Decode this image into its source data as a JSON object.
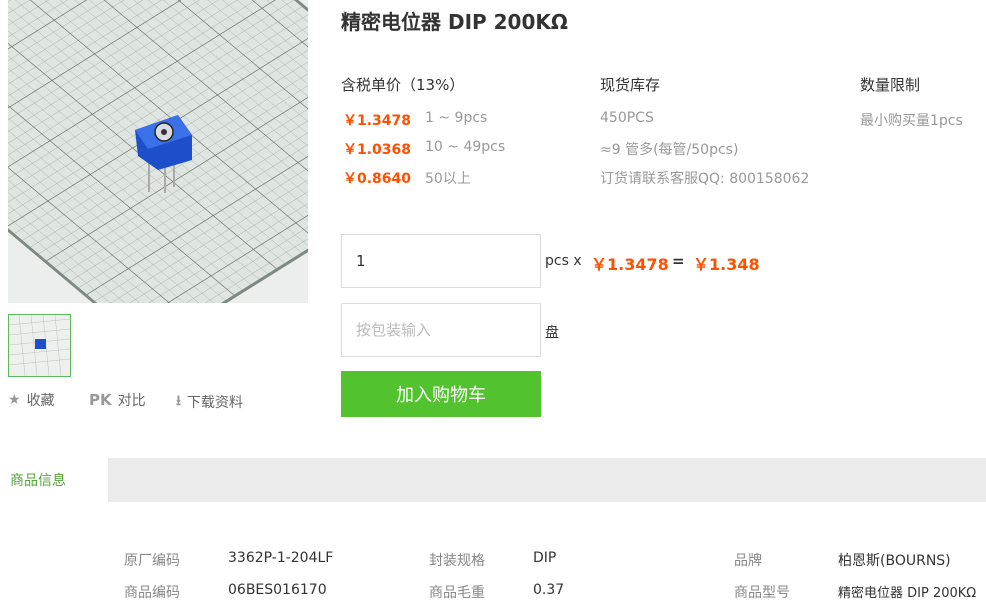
{
  "product": {
    "title": "精密电位器 DIP 200KΩ"
  },
  "image": {
    "alt": "product-photo"
  },
  "actions": [
    {
      "icon": "★",
      "label": "收藏"
    },
    {
      "icon": "PK",
      "label": "对比"
    },
    {
      "icon": "⭳",
      "label": "下载资料"
    }
  ],
  "pricing": {
    "header": "含税单价（13%）",
    "tiers": [
      {
        "price": "￥1.3478",
        "range": "1 ~ 9pcs"
      },
      {
        "price": "￥1.0368",
        "range": "10 ~ 49pcs"
      },
      {
        "price": "￥0.8640",
        "range": "50以上"
      }
    ]
  },
  "stock": {
    "header": "现货库存",
    "lines": [
      "450PCS",
      "≈9 管多(每管/50pcs)",
      "订货请联系客服QQ: 800158062"
    ]
  },
  "limit": {
    "header": "数量限制",
    "text": "最小购买量1pcs"
  },
  "order": {
    "qty_value": "1",
    "unit_label": "pcs x",
    "unit_price": "￥1.3478",
    "equals": "=",
    "total": "￥1.348",
    "pack_placeholder": "按包装输入",
    "pack_unit": "盘",
    "cart_label": "加入购物车"
  },
  "tabs": {
    "active": "商品信息"
  },
  "specs": {
    "row1": [
      {
        "label": "原厂编码",
        "value": "3362P-1-204LF"
      },
      {
        "label": "封装规格",
        "value": "DIP"
      },
      {
        "label": "品牌",
        "value": "柏恩斯(BOURNS)"
      }
    ],
    "row2": [
      {
        "label": "商品编码",
        "value": "06BES016170"
      },
      {
        "label": "商品毛重",
        "value": "0.37"
      },
      {
        "label": "商品型号",
        "value": "精密电位器 DIP 200KΩ"
      }
    ]
  },
  "colors": {
    "accent_price": "#ff5000",
    "cart_green": "#52c32f",
    "tab_green": "#52a535"
  }
}
